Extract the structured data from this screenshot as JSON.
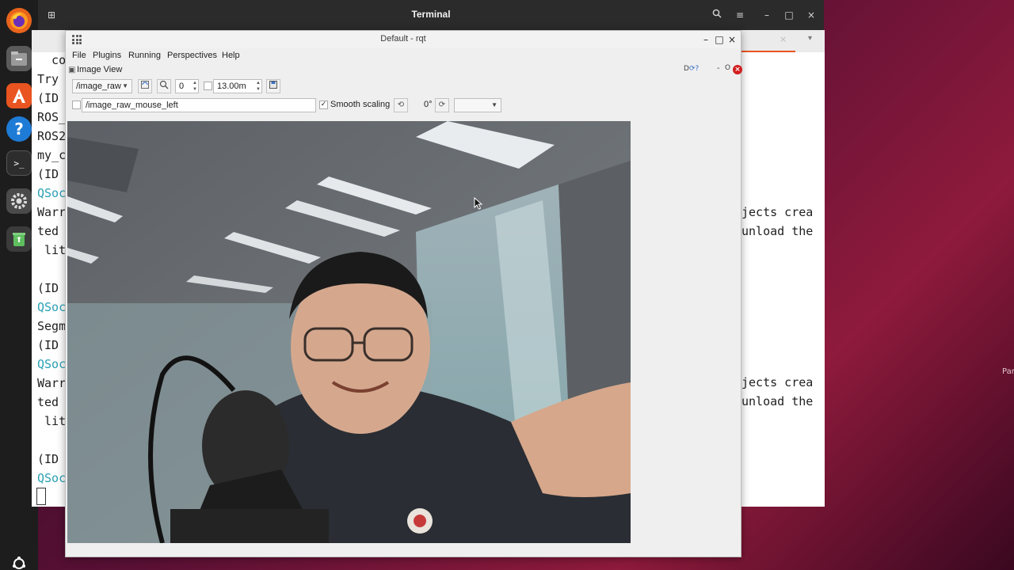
{
  "topbar": {
    "title": "Terminal"
  },
  "terminal": {
    "lines_left": [
      {
        "text": "  co",
        "cyan": false
      },
      {
        "text": "Try",
        "cyan": false
      },
      {
        "text": "(ID",
        "cyan": false
      },
      {
        "text": "ROS_",
        "cyan": false
      },
      {
        "text": "ROS2",
        "cyan": false
      },
      {
        "text": "my_c",
        "cyan": false
      },
      {
        "text": "(ID",
        "cyan": false
      },
      {
        "text": "QSoc",
        "cyan": true
      },
      {
        "text": "Warr",
        "cyan": false
      },
      {
        "text": "ted",
        "cyan": false
      },
      {
        "text": " lit",
        "cyan": false
      },
      {
        "text": "",
        "cyan": false
      },
      {
        "text": "(ID",
        "cyan": false
      },
      {
        "text": "QSoc",
        "cyan": true
      },
      {
        "text": "Segm",
        "cyan": false
      },
      {
        "text": "(ID",
        "cyan": false
      },
      {
        "text": "QSoc",
        "cyan": true
      },
      {
        "text": "Warr",
        "cyan": false
      },
      {
        "text": "ted",
        "cyan": false
      },
      {
        "text": " lit",
        "cyan": false
      },
      {
        "text": "",
        "cyan": false
      },
      {
        "text": "(ID",
        "cyan": false
      },
      {
        "text": "QSoc",
        "cyan": true
      }
    ],
    "right_1": "jects crea",
    "right_2": "unload the",
    "right_3": "jects crea",
    "right_4": "unload the"
  },
  "desktop": {
    "side_text": "Par"
  },
  "rqt": {
    "window_title": "Default - rqt",
    "menu": {
      "file": "File",
      "plugins": "Plugins",
      "running": "Running",
      "perspectives": "Perspectives",
      "help": "Help"
    },
    "plugin": {
      "title": "Image View",
      "topic": "/image_raw",
      "zoom_value": "0",
      "max_range": "13.00m",
      "mouse_topic": "/image_raw_mouse_left",
      "smooth_scaling_label": "Smooth scaling",
      "smooth_scaling_checked": true,
      "rotation": "0°",
      "dock_icons_text": "D",
      "dock_min": "-",
      "dock_float": "O"
    }
  },
  "colors": {
    "ubuntu_orange": "#e95420",
    "close_red": "#d21e1e",
    "terminal_cyan": "#2aa1b3"
  }
}
